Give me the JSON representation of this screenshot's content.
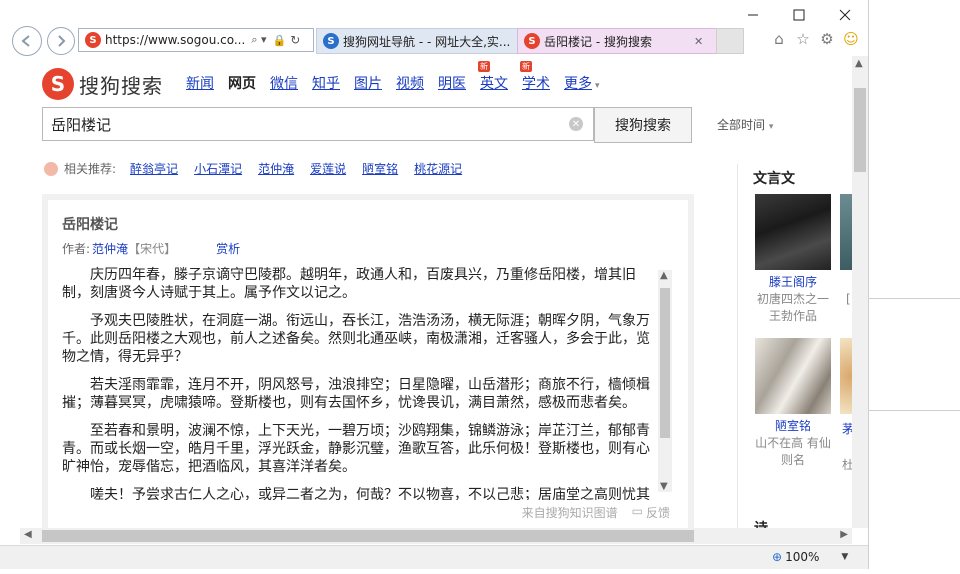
{
  "browser": {
    "address": "https://www.sogou.co...",
    "address_dropdown": "⌕ ▾",
    "tabs": [
      {
        "label": "搜狗网址导航 - - 网址大全,实..."
      },
      {
        "label": "岳阳楼记 - 搜狗搜索",
        "close": "✕"
      }
    ],
    "zoom": "100%"
  },
  "header": {
    "logo_text": "搜狗搜索",
    "logo_glyph": "S",
    "channels": [
      {
        "label": "新闻"
      },
      {
        "label": "网页"
      },
      {
        "label": "微信"
      },
      {
        "label": "知乎"
      },
      {
        "label": "图片"
      },
      {
        "label": "视频"
      },
      {
        "label": "明医"
      },
      {
        "label": "英文",
        "badge": "新"
      },
      {
        "label": "学术",
        "badge": "新"
      },
      {
        "label": "更多"
      }
    ]
  },
  "search": {
    "query": "岳阳楼记",
    "button_label": "搜狗搜索",
    "time_filter": "全部时间"
  },
  "related": {
    "label": "相关推荐:",
    "items": [
      "醉翁亭记",
      "小石潭记",
      "范仲淹",
      "爱莲说",
      "陋室铭",
      "桃花源记"
    ]
  },
  "card": {
    "title": "岳阳楼记",
    "author_label": "作者:",
    "author": "范仲淹",
    "dynasty": "【宋代】",
    "appreciation": "赏析",
    "paragraphs": [
      "庆历四年春，滕子京谪守巴陵郡。越明年，政通人和，百废具兴，乃重修岳阳楼，增其旧制，刻唐贤今人诗赋于其上。属予作文以记之。",
      "予观夫巴陵胜状，在洞庭一湖。衔远山，吞长江，浩浩汤汤，横无际涯；朝晖夕阴，气象万千。此则岳阳楼之大观也，前人之述备矣。然则北通巫峡，南极潇湘，迁客骚人，多会于此，览物之情，得无异乎？",
      "若夫淫雨霏霏，连月不开，阴风怒号，浊浪排空；日星隐曜，山岳潜形；商旅不行，樯倾楫摧；薄暮冥冥，虎啸猿啼。登斯楼也，则有去国怀乡，忧谗畏讥，满目萧然，感极而悲者矣。",
      "至若春和景明，波澜不惊，上下天光，一碧万顷；沙鸥翔集，锦鳞游泳；岸芷汀兰，郁郁青青。而或长烟一空，皓月千里，浮光跃金，静影沉璧，渔歌互答，此乐何极！登斯楼也，则有心旷神怡，宠辱偕忘，把酒临风，其喜洋洋者矣。",
      "嗟夫！予尝求古仁人之心，或异二者之为，何哉？不以物喜，不以己悲；居庙堂之高则忧其民；处江湖之远则忧其君。是进亦忧，退亦忧。然则何时而乐耶？"
    ],
    "source": "来自搜狗知识图谱",
    "feedback": "反馈"
  },
  "sidebar": {
    "title": "文言文",
    "items": [
      {
        "name": "滕王阁序",
        "desc": "初唐四杰之一王勃作品"
      },
      {
        "name": "陋室铭",
        "desc": "山不在高 有仙则名"
      }
    ],
    "peek_top": "[",
    "peek_bottom_1": "茅",
    "peek_bottom_2": "杜",
    "bottom_peek": "诗"
  },
  "colors": {
    "brand": "#e5432d",
    "link": "#1a3dc1",
    "active_tab": "#f3dff4",
    "inactive_tab": "#dfe7f2"
  }
}
